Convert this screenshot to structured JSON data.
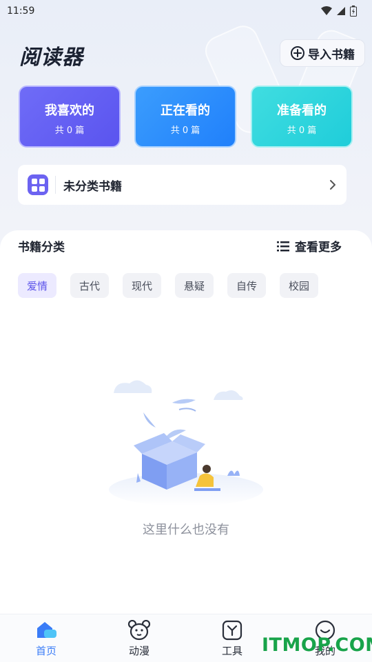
{
  "status_bar": {
    "time": "11:59"
  },
  "header": {
    "title": "阅读器",
    "import_label": "导入书籍"
  },
  "cards": [
    {
      "title": "我喜欢的",
      "count": "共 0 篇"
    },
    {
      "title": "正在看的",
      "count": "共 0 篇"
    },
    {
      "title": "准备看的",
      "count": "共 0 篇"
    }
  ],
  "uncategorized": {
    "label": "未分类书籍"
  },
  "categories": {
    "title": "书籍分类",
    "more_label": "查看更多",
    "tags": [
      "爱情",
      "古代",
      "现代",
      "悬疑",
      "自传",
      "校园"
    ],
    "active_tag": "爱情"
  },
  "empty_state": {
    "text": "这里什么也没有"
  },
  "bottom_nav": [
    {
      "label": "首页",
      "icon": "home-icon",
      "active": true
    },
    {
      "label": "动漫",
      "icon": "bear-face-icon",
      "active": false
    },
    {
      "label": "工具",
      "icon": "tool-icon",
      "active": false
    },
    {
      "label": "我的",
      "icon": "smile-face-icon",
      "active": false
    }
  ],
  "watermark": "ITMOP.COM",
  "colors": {
    "accent": "#3a7cf7",
    "card_favorite": "#5a54ef",
    "card_reading": "#2080fb",
    "card_plan": "#1fcdda",
    "tag_active": "#5d55ea"
  }
}
